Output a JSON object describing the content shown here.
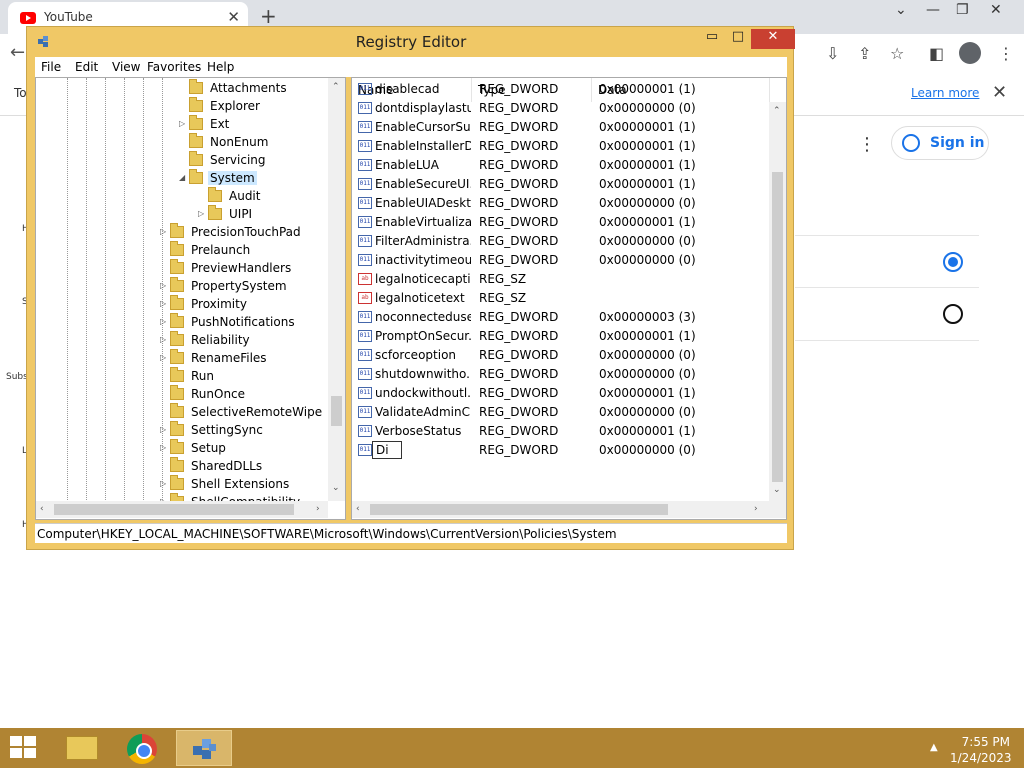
{
  "browser": {
    "tab_title": "YouTube",
    "tab_close": "✕",
    "new_tab": "+",
    "infobar_prefix": "To",
    "learn_more": "Learn more",
    "infobar_close": "✕",
    "sign_in": "Sign in",
    "side_letters": [
      "H",
      "S",
      "Subs",
      "L",
      "H"
    ]
  },
  "window": {
    "title": "Registry Editor",
    "min": "▭",
    "max": "□",
    "close": "✕"
  },
  "menu": [
    "File",
    "Edit",
    "View",
    "Favorites",
    "Help"
  ],
  "tree": [
    {
      "label": "Attachments",
      "indent": 1,
      "expander": ""
    },
    {
      "label": "Explorer",
      "indent": 1,
      "expander": ""
    },
    {
      "label": "Ext",
      "indent": 1,
      "expander": "▷"
    },
    {
      "label": "NonEnum",
      "indent": 1,
      "expander": ""
    },
    {
      "label": "Servicing",
      "indent": 1,
      "expander": ""
    },
    {
      "label": "System",
      "indent": 1,
      "expander": "◢",
      "selected": true
    },
    {
      "label": "Audit",
      "indent": 2,
      "expander": ""
    },
    {
      "label": "UIPI",
      "indent": 2,
      "expander": "▷"
    },
    {
      "label": "PrecisionTouchPad",
      "indent": 0,
      "expander": "▷"
    },
    {
      "label": "Prelaunch",
      "indent": 0,
      "expander": ""
    },
    {
      "label": "PreviewHandlers",
      "indent": 0,
      "expander": ""
    },
    {
      "label": "PropertySystem",
      "indent": 0,
      "expander": "▷"
    },
    {
      "label": "Proximity",
      "indent": 0,
      "expander": "▷"
    },
    {
      "label": "PushNotifications",
      "indent": 0,
      "expander": "▷"
    },
    {
      "label": "Reliability",
      "indent": 0,
      "expander": "▷"
    },
    {
      "label": "RenameFiles",
      "indent": 0,
      "expander": "▷"
    },
    {
      "label": "Run",
      "indent": 0,
      "expander": ""
    },
    {
      "label": "RunOnce",
      "indent": 0,
      "expander": ""
    },
    {
      "label": "SelectiveRemoteWipe",
      "indent": 0,
      "expander": ""
    },
    {
      "label": "SettingSync",
      "indent": 0,
      "expander": "▷"
    },
    {
      "label": "Setup",
      "indent": 0,
      "expander": "▷"
    },
    {
      "label": "SharedDLLs",
      "indent": 0,
      "expander": ""
    },
    {
      "label": "Shell Extensions",
      "indent": 0,
      "expander": "▷"
    },
    {
      "label": "ShellCompatibility",
      "indent": 0,
      "expander": "▷"
    }
  ],
  "columns": {
    "name": "Name",
    "type": "Type",
    "data": "Data"
  },
  "values": [
    {
      "name": "disablecad",
      "type": "REG_DWORD",
      "data": "0x00000001 (1)",
      "kind": "dword"
    },
    {
      "name": "dontdisplaylastu...",
      "type": "REG_DWORD",
      "data": "0x00000000 (0)",
      "kind": "dword"
    },
    {
      "name": "EnableCursorSu...",
      "type": "REG_DWORD",
      "data": "0x00000001 (1)",
      "kind": "dword"
    },
    {
      "name": "EnableInstallerD...",
      "type": "REG_DWORD",
      "data": "0x00000001 (1)",
      "kind": "dword"
    },
    {
      "name": "EnableLUA",
      "type": "REG_DWORD",
      "data": "0x00000001 (1)",
      "kind": "dword"
    },
    {
      "name": "EnableSecureUI...",
      "type": "REG_DWORD",
      "data": "0x00000001 (1)",
      "kind": "dword"
    },
    {
      "name": "EnableUIADeskt...",
      "type": "REG_DWORD",
      "data": "0x00000000 (0)",
      "kind": "dword"
    },
    {
      "name": "EnableVirtualizat...",
      "type": "REG_DWORD",
      "data": "0x00000001 (1)",
      "kind": "dword"
    },
    {
      "name": "FilterAdministra...",
      "type": "REG_DWORD",
      "data": "0x00000000 (0)",
      "kind": "dword"
    },
    {
      "name": "inactivitytimeou...",
      "type": "REG_DWORD",
      "data": "0x00000000 (0)",
      "kind": "dword"
    },
    {
      "name": "legalnoticecapti...",
      "type": "REG_SZ",
      "data": "",
      "kind": "sz"
    },
    {
      "name": "legalnoticetext",
      "type": "REG_SZ",
      "data": "",
      "kind": "sz"
    },
    {
      "name": "noconnecteduser",
      "type": "REG_DWORD",
      "data": "0x00000003 (3)",
      "kind": "dword"
    },
    {
      "name": "PromptOnSecur...",
      "type": "REG_DWORD",
      "data": "0x00000001 (1)",
      "kind": "dword"
    },
    {
      "name": "scforceoption",
      "type": "REG_DWORD",
      "data": "0x00000000 (0)",
      "kind": "dword"
    },
    {
      "name": "shutdownwitho...",
      "type": "REG_DWORD",
      "data": "0x00000000 (0)",
      "kind": "dword"
    },
    {
      "name": "undockwithoutl...",
      "type": "REG_DWORD",
      "data": "0x00000001 (1)",
      "kind": "dword"
    },
    {
      "name": "ValidateAdminC...",
      "type": "REG_DWORD",
      "data": "0x00000000 (0)",
      "kind": "dword"
    },
    {
      "name": "VerboseStatus",
      "type": "REG_DWORD",
      "data": "0x00000001 (1)",
      "kind": "dword"
    },
    {
      "name": "Di",
      "type": "REG_DWORD",
      "data": "0x00000000 (0)",
      "kind": "dword",
      "editing": true
    }
  ],
  "value_icon_text": {
    "dword": "011",
    "sz": "ab"
  },
  "status_path": "Computer\\HKEY_LOCAL_MACHINE\\SOFTWARE\\Microsoft\\Windows\\CurrentVersion\\Policies\\System",
  "taskbar": {
    "time": "7:55 PM",
    "date": "1/24/2023",
    "tray_arrow": "▲"
  },
  "colors": {
    "window_frame": "#f0c866",
    "close_button": "#c94031",
    "taskbar": "#b08433",
    "link": "#1a73e8"
  }
}
